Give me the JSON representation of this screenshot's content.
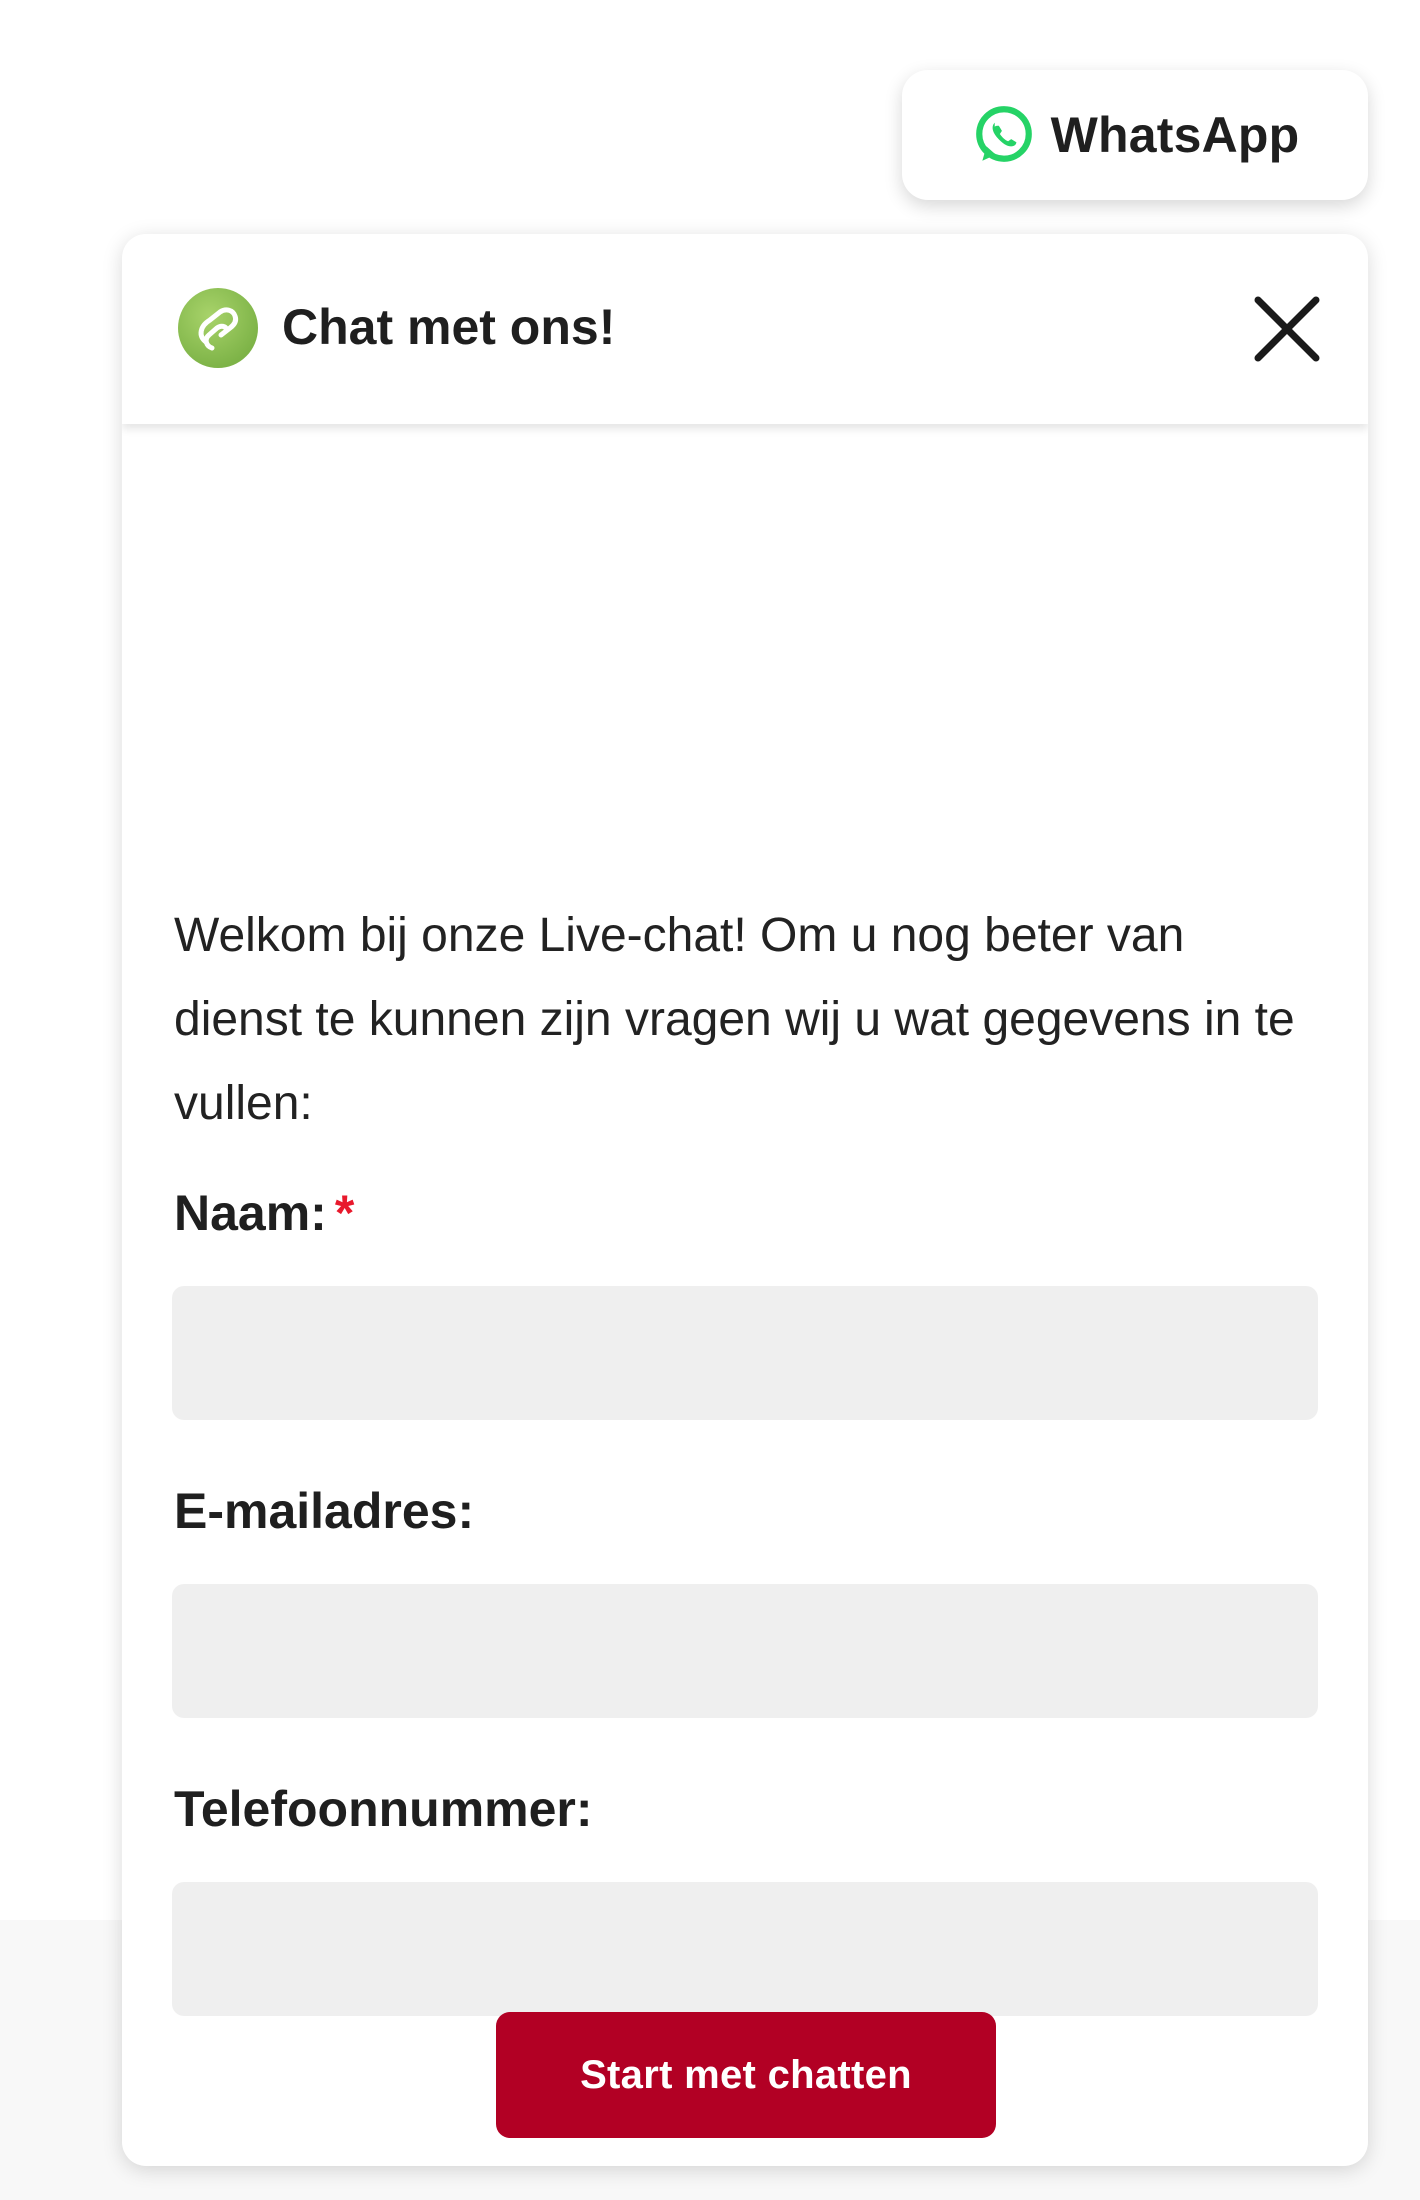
{
  "whatsapp": {
    "label": "WhatsApp",
    "icon": "whatsapp-icon",
    "color": "#25d366"
  },
  "chat": {
    "title": "Chat met ons!",
    "logo_icon": "chat-brand-logo-icon",
    "logo_color": "#8cc152",
    "close_icon": "close-icon",
    "intro": "Welkom bij onze Live-chat! Om u nog beter van dienst te kunnen zijn vragen wij u wat gegevens in te vullen:",
    "fields": {
      "name": {
        "label": "Naam:",
        "required_mark": "*",
        "value": ""
      },
      "email": {
        "label": "E-mailadres:",
        "value": ""
      },
      "phone": {
        "label": "Telefoonnummer:",
        "value": ""
      }
    },
    "submit_label": "Start met chatten",
    "accent_color": "#b20024",
    "required_color": "#e8192c"
  }
}
